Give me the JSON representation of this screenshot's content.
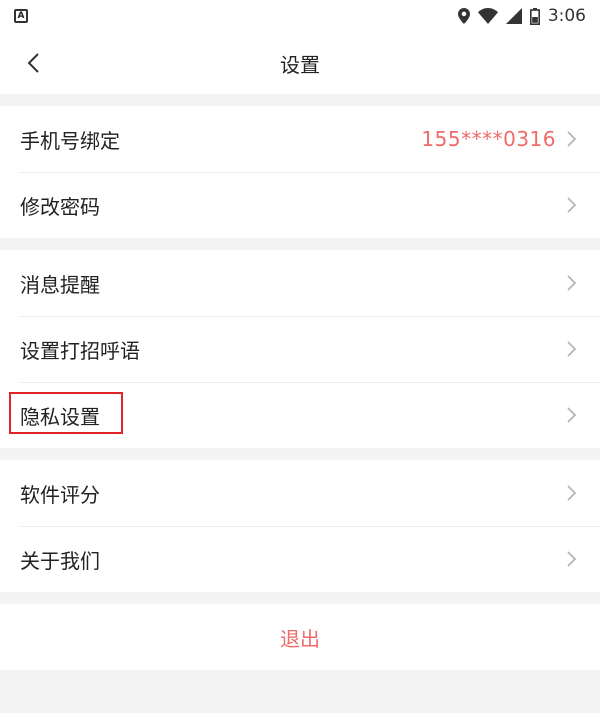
{
  "status_bar": {
    "time": "3:06",
    "icons": [
      "notification-a-icon",
      "location-icon",
      "wifi-icon",
      "signal-icon",
      "battery-icon"
    ]
  },
  "header": {
    "title": "设置",
    "back_icon": "chevron-left-icon"
  },
  "groups": [
    {
      "items": [
        {
          "label": "手机号绑定",
          "value": "155****0316"
        },
        {
          "label": "修改密码"
        }
      ]
    },
    {
      "items": [
        {
          "label": "消息提醒"
        },
        {
          "label": "设置打招呼语"
        },
        {
          "label": "隐私设置",
          "highlighted": true
        }
      ]
    },
    {
      "items": [
        {
          "label": "软件评分"
        },
        {
          "label": "关于我们"
        }
      ]
    }
  ],
  "logout_label": "退出",
  "colors": {
    "accent": "#f06a6a",
    "highlight_border": "#e0242a",
    "background": "#f4f4f4"
  }
}
